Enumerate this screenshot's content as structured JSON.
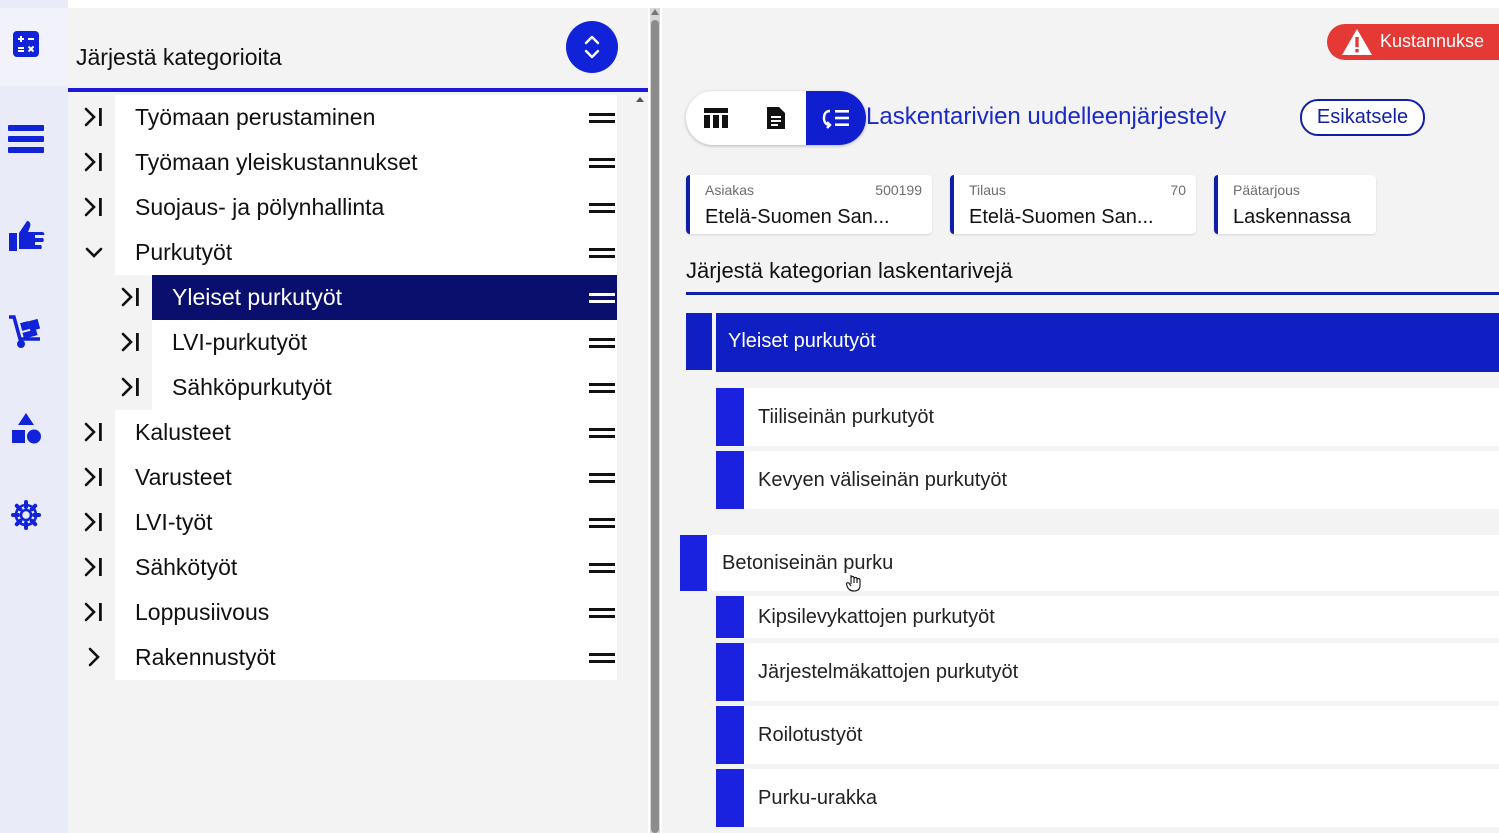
{
  "rail": {
    "icons": [
      "calculator-icon",
      "list-icon",
      "hand-pointing-icon",
      "hand-cart-icon",
      "shapes-icon",
      "gear-icon"
    ]
  },
  "categories_panel": {
    "title": "Järjestä kategorioita",
    "sort_icon": "sort-updown-icon",
    "items": [
      {
        "label": "Työmaan perustaminen",
        "chevron": "expand-right-icon"
      },
      {
        "label": "Työmaan yleiskustannukset",
        "chevron": "expand-right-icon"
      },
      {
        "label": "Suojaus- ja pölynhallinta",
        "chevron": "expand-right-icon"
      },
      {
        "label": "Purkutyöt",
        "chevron": "chevron-down-icon"
      },
      {
        "label": "Yleiset purkutyöt",
        "chevron": "expand-right-icon",
        "selected": true
      },
      {
        "label": "LVI-purkutyöt",
        "chevron": "expand-right-icon"
      },
      {
        "label": "Sähköpurkutyöt",
        "chevron": "expand-right-icon"
      },
      {
        "label": "Kalusteet",
        "chevron": "expand-right-icon"
      },
      {
        "label": "Varusteet",
        "chevron": "expand-right-icon"
      },
      {
        "label": "LVI-työt",
        "chevron": "expand-right-icon"
      },
      {
        "label": "Sähkötyöt",
        "chevron": "expand-right-icon"
      },
      {
        "label": "Loppusiivous",
        "chevron": "expand-right-icon"
      },
      {
        "label": "Rakennustyöt",
        "chevron": "chevron-right-icon"
      }
    ]
  },
  "header": {
    "warning_label": "Kustannukse",
    "warning_icon": "warning-triangle-icon"
  },
  "toolbar": {
    "buttons": [
      "table-icon",
      "document-icon",
      "reorder-list-icon"
    ],
    "title": "Laskentarivien uudelleenjärjestely",
    "preview_label": "Esikatsele"
  },
  "info_cards": [
    {
      "label": "Asiakas",
      "number": "500199",
      "value": "Etelä-Suomen San..."
    },
    {
      "label": "Tilaus",
      "number": "70",
      "value": "Etelä-Suomen San..."
    },
    {
      "label": "Päätarjous",
      "number": "",
      "value": "Laskennassa"
    }
  ],
  "rows_section": {
    "title": "Järjestä kategorian laskentarivejä",
    "selected_category": "Yleiset purkutyöt",
    "rows": [
      {
        "label": "Tiiliseinän purkutyöt"
      },
      {
        "label": "Kevyen väliseinän purkutyöt"
      },
      {
        "label": "Betoniseinän purku",
        "dragging": true
      },
      {
        "label": "Kipsilevykattojen purkutyöt"
      },
      {
        "label": "Järjestelmäkattojen purkutyöt"
      },
      {
        "label": "Roilotustyöt"
      },
      {
        "label": "Purku-urakka"
      }
    ]
  },
  "colors": {
    "accent": "#1023d8",
    "selected_dark": "#0a0f6e",
    "warning": "#e53935",
    "rail_bg": "#e9ebf9"
  }
}
